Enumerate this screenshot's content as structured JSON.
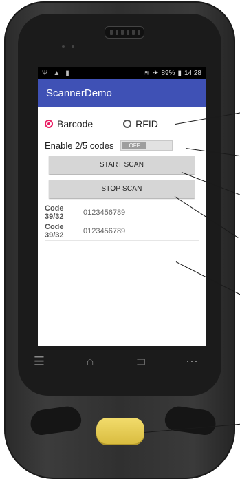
{
  "status_bar": {
    "left_icons": [
      "usb-icon",
      "warning-icon",
      "notification-icon"
    ],
    "battery_percent": "89%",
    "time": "14:28"
  },
  "app_bar": {
    "title": "ScannerDemo",
    "color": "#3f51b5"
  },
  "scan_mode": {
    "options": [
      {
        "label": "Barcode",
        "selected": true
      },
      {
        "label": "RFID",
        "selected": false
      }
    ],
    "accent_color": "#e91e63"
  },
  "codes_toggle": {
    "label": "Enable 2/5 codes",
    "state": "OFF"
  },
  "buttons": {
    "start": "START SCAN",
    "stop": "STOP SCAN"
  },
  "results": [
    {
      "type": "Code 39/32",
      "value": "0123456789"
    },
    {
      "type": "Code 39/32",
      "value": "0123456789"
    }
  ],
  "nav_buttons": [
    "menu-icon",
    "home-icon",
    "back-icon",
    "more-icon"
  ]
}
